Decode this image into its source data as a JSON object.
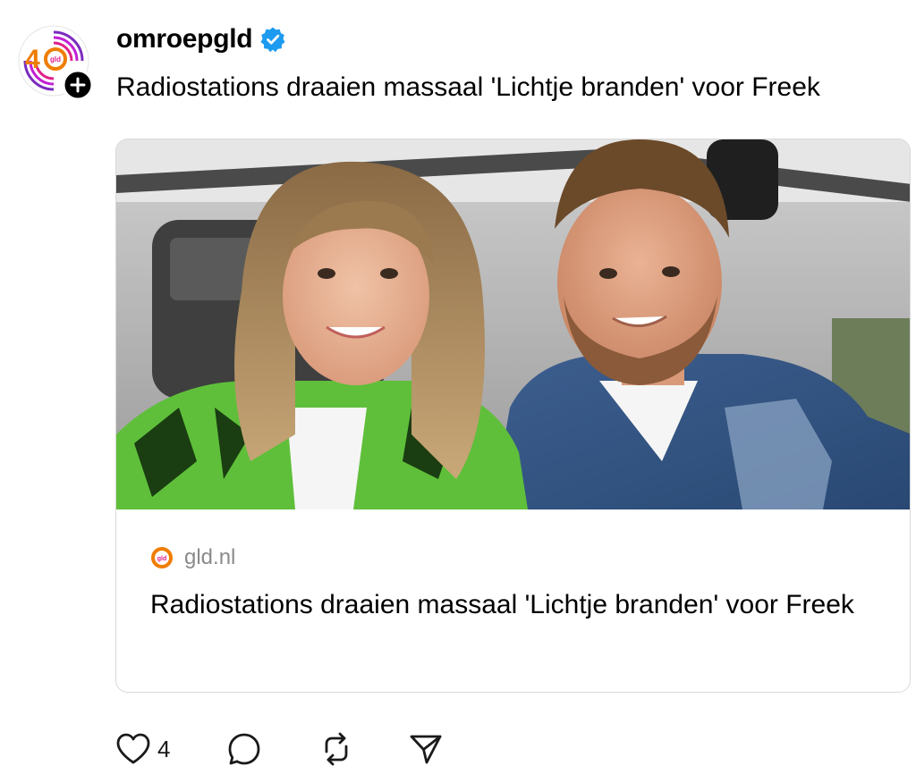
{
  "post": {
    "username": "omroepgld",
    "text": "Radiostations draaien massaal 'Lichtje branden' voor Freek"
  },
  "avatar": {
    "icon": "omroep-gelderland-40-logo",
    "logo_text": "gld"
  },
  "link_card": {
    "domain": "gld.nl",
    "title": "Radiostations draaien massaal 'Lichtje branden' voor Freek",
    "source_icon_text": "gld"
  },
  "actions": {
    "like_count": "4",
    "icons": [
      "heart-icon",
      "comment-icon",
      "repost-icon",
      "share-icon"
    ]
  },
  "colors": {
    "verified": "#1d9bf0",
    "text": "#000000",
    "muted": "#8a8a8a",
    "border": "#d9d9d9",
    "brand_orange": "#ef7d00",
    "brand_purple": "#7b2cbf"
  }
}
